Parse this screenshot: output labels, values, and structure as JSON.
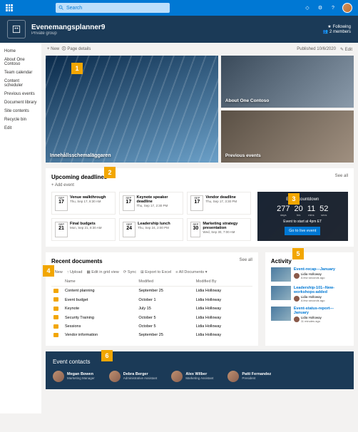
{
  "topbar": {
    "search_placeholder": "Search",
    "icons": [
      "notifications",
      "settings",
      "help"
    ]
  },
  "site": {
    "title": "Evenemangsplanner9",
    "subtitle": "Private group",
    "following_label": "Following",
    "members_label": "2 members"
  },
  "leftnav": {
    "items": [
      "Home",
      "About One Contoso",
      "Team calendar",
      "Content scheduler",
      "Previous events",
      "Document library",
      "Site contents",
      "Recycle bin",
      "Edit"
    ]
  },
  "cmdbar": {
    "new": "New",
    "page_details": "Page details",
    "published": "Published 10/6/2020",
    "edit": "Edit"
  },
  "hero": {
    "big_caption": "Innehållsschemaläggaren",
    "tile2_caption": "About One Contoso",
    "tile3_caption": "Previous events"
  },
  "deadlines": {
    "title": "Upcoming deadlines",
    "seeall": "See all",
    "add": "Add event",
    "cards": [
      {
        "mon": "SEP",
        "day": "17",
        "title": "Venue walkthrough",
        "sub": "Thu, Sep 17, 8:30 AM"
      },
      {
        "mon": "SEP",
        "day": "17",
        "title": "Keynote speaker deadline",
        "sub": "Thu, Sep 17, 2:30 PM"
      },
      {
        "mon": "SEP",
        "day": "17",
        "title": "Vendor deadline",
        "sub": "Thu, Sep 17, 3:30 PM"
      },
      {
        "mon": "SEP",
        "day": "21",
        "title": "Final budgets",
        "sub": "Mon, Sep 21, 8:30 AM"
      },
      {
        "mon": "SEP",
        "day": "24",
        "title": "Leadership lunch",
        "sub": "Thu, Sep 24, 2:00 PM"
      },
      {
        "mon": "SEP",
        "day": "30",
        "title": "Marketing strategy presentation",
        "sub": "Wed, Sep 30, 7:00 AM"
      }
    ]
  },
  "countdown": {
    "title": "Event countdown",
    "nums": [
      {
        "v": "277",
        "l": "days"
      },
      {
        "v": "20",
        "l": "hrs"
      },
      {
        "v": "11",
        "l": "mins"
      },
      {
        "v": "52",
        "l": "secs"
      }
    ],
    "sub": "Event to start at 4pm ET",
    "btn": "Go to live event"
  },
  "docs": {
    "title": "Recent documents",
    "seeall": "See all",
    "bar": {
      "new": "New",
      "upload": "Upload",
      "grid": "Edit in grid view",
      "sync": "Sync",
      "excel": "Export to Excel",
      "alldocs": "All Documents"
    },
    "cols": {
      "name": "Name",
      "modified": "Modified",
      "by": "Modified By"
    },
    "rows": [
      {
        "name": "Content planning",
        "modified": "September 25",
        "by": "Lidia Holloway"
      },
      {
        "name": "Event budget",
        "modified": "October 1",
        "by": "Lidia Holloway"
      },
      {
        "name": "Keynote",
        "modified": "July 15",
        "by": "Lidia Holloway"
      },
      {
        "name": "Security Training",
        "modified": "October 5",
        "by": "Lidia Holloway"
      },
      {
        "name": "Sessions",
        "modified": "October 5",
        "by": "Lidia Holloway"
      },
      {
        "name": "Vendor information",
        "modified": "September 25",
        "by": "Lidia Holloway"
      }
    ]
  },
  "activity": {
    "title": "Activity",
    "items": [
      {
        "title": "Event-recap---January",
        "by": "Lidia Holloway",
        "when": "A few seconds ago"
      },
      {
        "title": "Leadership-101--New-workshops-added",
        "by": "Lidia Holloway",
        "when": "A few seconds ago"
      },
      {
        "title": "Event-status-report---January",
        "by": "Lidia Holloway",
        "when": "11 minutes ago"
      }
    ]
  },
  "contacts": {
    "title": "Event contacts",
    "people": [
      {
        "name": "Megan Bowen",
        "role": "Marketing Manager"
      },
      {
        "name": "Debra Berger",
        "role": "Administrative Assistant"
      },
      {
        "name": "Alex Wilber",
        "role": "Marketing Assistant"
      },
      {
        "name": "Patti Fernandez",
        "role": "President"
      }
    ]
  },
  "callouts": [
    "1",
    "2",
    "3",
    "4",
    "5",
    "6"
  ]
}
